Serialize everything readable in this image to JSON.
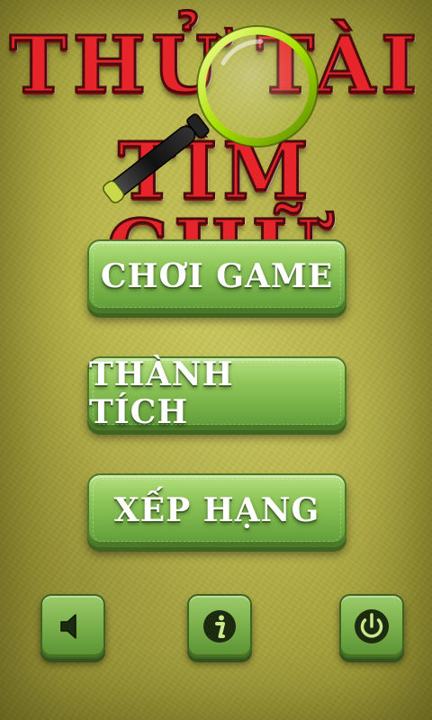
{
  "title": {
    "line1": "THỬ TÀI",
    "line2": "TÌM CHỮ"
  },
  "menu": {
    "play_label": "CHƠI GAME",
    "achievements_label": "THÀNH TÍCH",
    "ranking_label": "XẾP HẠNG"
  },
  "bottom_bar": {
    "icons": [
      "speaker-icon",
      "info-icon",
      "power-icon"
    ]
  },
  "colors": {
    "title_red": "#e8242b",
    "button_green": "#8fc65a",
    "background": "#b9b64a"
  }
}
